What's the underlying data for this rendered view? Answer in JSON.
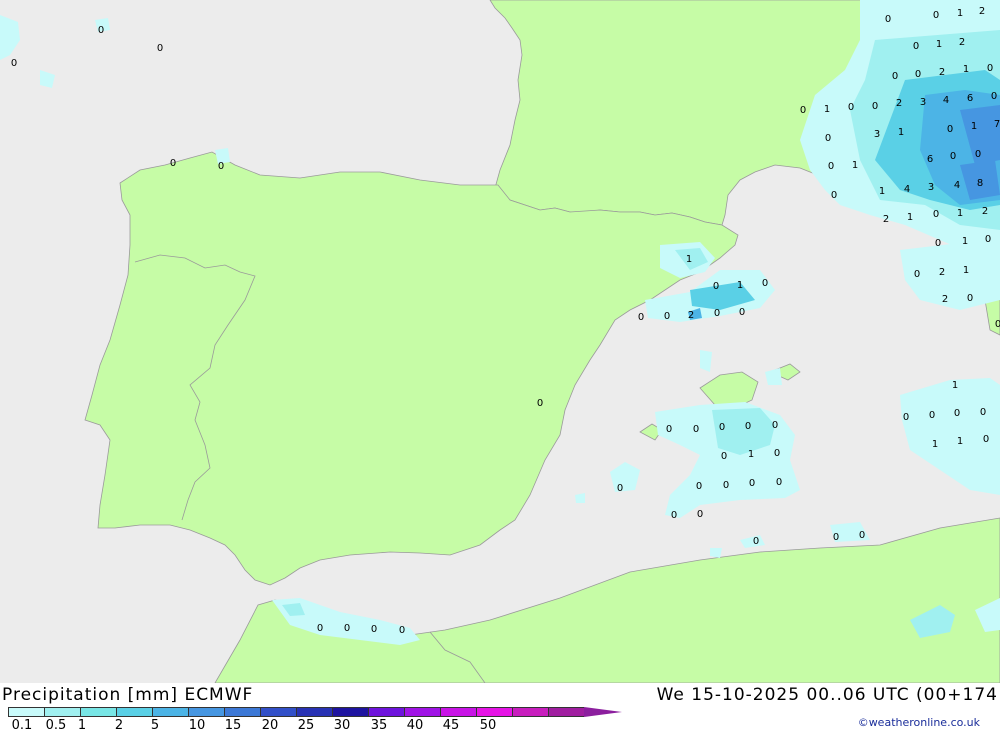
{
  "map": {
    "colors": {
      "sea": "#ececec",
      "land": "#c6fca6",
      "border": "#9a9a9a"
    },
    "precip_values": [
      "0",
      "0",
      "0",
      "0",
      "0",
      "0",
      "0",
      "1",
      "2",
      "0",
      "1",
      "2",
      "0",
      "0",
      "2",
      "1",
      "0",
      "0",
      "1",
      "0",
      "0",
      "2",
      "3",
      "4",
      "6",
      "0",
      "0",
      "1",
      "3",
      "0",
      "1",
      "7",
      "0",
      "1",
      "6",
      "0",
      "0",
      "0",
      "1",
      "4",
      "8",
      "4",
      "3",
      "2",
      "1",
      "1",
      "2",
      "0",
      "1",
      "0",
      "0",
      "0",
      "2",
      "1",
      "2",
      "0",
      "0",
      "1",
      "0",
      "1",
      "0",
      "0",
      "0",
      "2",
      "0",
      "0",
      "0",
      "0",
      "0",
      "0",
      "0",
      "0",
      "0",
      "1",
      "0",
      "1",
      "0",
      "0",
      "0",
      "0",
      "1",
      "1",
      "0",
      "0",
      "0",
      "0",
      "0",
      "0",
      "0",
      "0",
      "0",
      "0",
      "0",
      "0",
      "0",
      "0",
      "0",
      "0",
      "0"
    ]
  },
  "footer": {
    "title_left": "Precipitation [mm] ECMWF",
    "title_right": "We 15-10-2025 00..06 UTC (00+174",
    "legend_colors": [
      "#c8fafa",
      "#a0f0f0",
      "#78e6e6",
      "#5ad0e6",
      "#4cb4e6",
      "#4696e1",
      "#3c78d6",
      "#3250c8",
      "#2832b4",
      "#1e14a0",
      "#6e14dc",
      "#a014e6",
      "#c814e6",
      "#e614e6",
      "#c81ebe",
      "#a01ea0"
    ],
    "legend_ticks": [
      "0.1",
      "0.5",
      "1",
      "2",
      "5",
      "10",
      "15",
      "20",
      "25",
      "30",
      "35",
      "40",
      "45",
      "50"
    ],
    "credit": "©weatheronline.co.uk"
  }
}
